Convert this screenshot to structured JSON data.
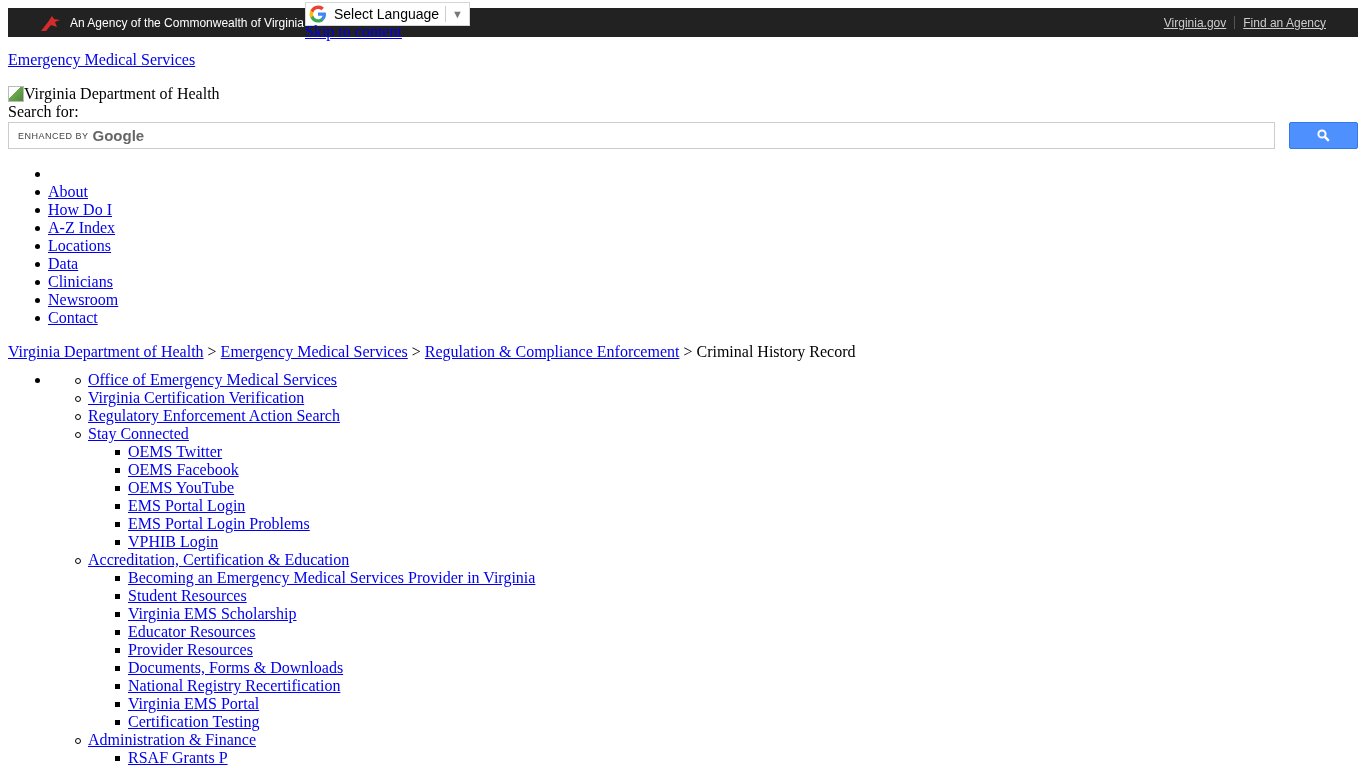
{
  "top_bar": {
    "agency_text": "An Agency of the Commonwealth of Virginia",
    "links": [
      "Virginia.gov",
      "Find an Agency"
    ]
  },
  "translate_widget": {
    "label": "Select Language",
    "arrow": "▼"
  },
  "skip_link": "Skip to content",
  "site_title": "Emergency Medical Services",
  "logo_alt": "Virginia Department of Health",
  "search": {
    "label": "Search for:",
    "enhanced_by": "ENHANCED BY",
    "brand": "Google"
  },
  "nav": [
    {
      "kind": "empty"
    },
    {
      "kind": "link",
      "label": "About"
    },
    {
      "kind": "link",
      "label": "How Do I"
    },
    {
      "kind": "link",
      "label": "A-Z Index"
    },
    {
      "kind": "link",
      "label": "Locations"
    },
    {
      "kind": "link",
      "label": "Data"
    },
    {
      "kind": "link",
      "label": "Clinicians"
    },
    {
      "kind": "link",
      "label": "Newsroom"
    },
    {
      "kind": "link",
      "label": "Contact"
    }
  ],
  "breadcrumb": {
    "links": [
      "Virginia Department of Health",
      "Emergency Medical Services",
      "Regulation & Compliance Enforcement"
    ],
    "separator": ">",
    "current": "Criminal History Record"
  },
  "sidebar": [
    {
      "children": [
        {
          "label": "Office of Emergency Medical Services"
        },
        {
          "label": "Virginia Certification Verification"
        },
        {
          "label": "Regulatory Enforcement Action Search"
        },
        {
          "label": "Stay Connected",
          "children": [
            {
              "label": "OEMS Twitter"
            },
            {
              "label": "OEMS Facebook"
            },
            {
              "label": "OEMS YouTube"
            },
            {
              "label": "EMS Portal Login"
            },
            {
              "label": "EMS Portal Login Problems"
            },
            {
              "label": "VPHIB Login"
            }
          ]
        },
        {
          "label": "Accreditation, Certification & Education",
          "children": [
            {
              "label": "Becoming an Emergency Medical Services Provider in Virginia"
            },
            {
              "label": "Student Resources"
            },
            {
              "label": "Virginia EMS Scholarship"
            },
            {
              "label": "Educator Resources"
            },
            {
              "label": "Provider Resources"
            },
            {
              "label": "Documents, Forms & Downloads"
            },
            {
              "label": "National Registry Recertification"
            },
            {
              "label": "Virginia EMS Portal"
            },
            {
              "label": "Certification Testing"
            }
          ]
        },
        {
          "label": "Administration & Finance",
          "children": [
            {
              "label": "RSAF Grants P"
            }
          ]
        }
      ]
    }
  ]
}
